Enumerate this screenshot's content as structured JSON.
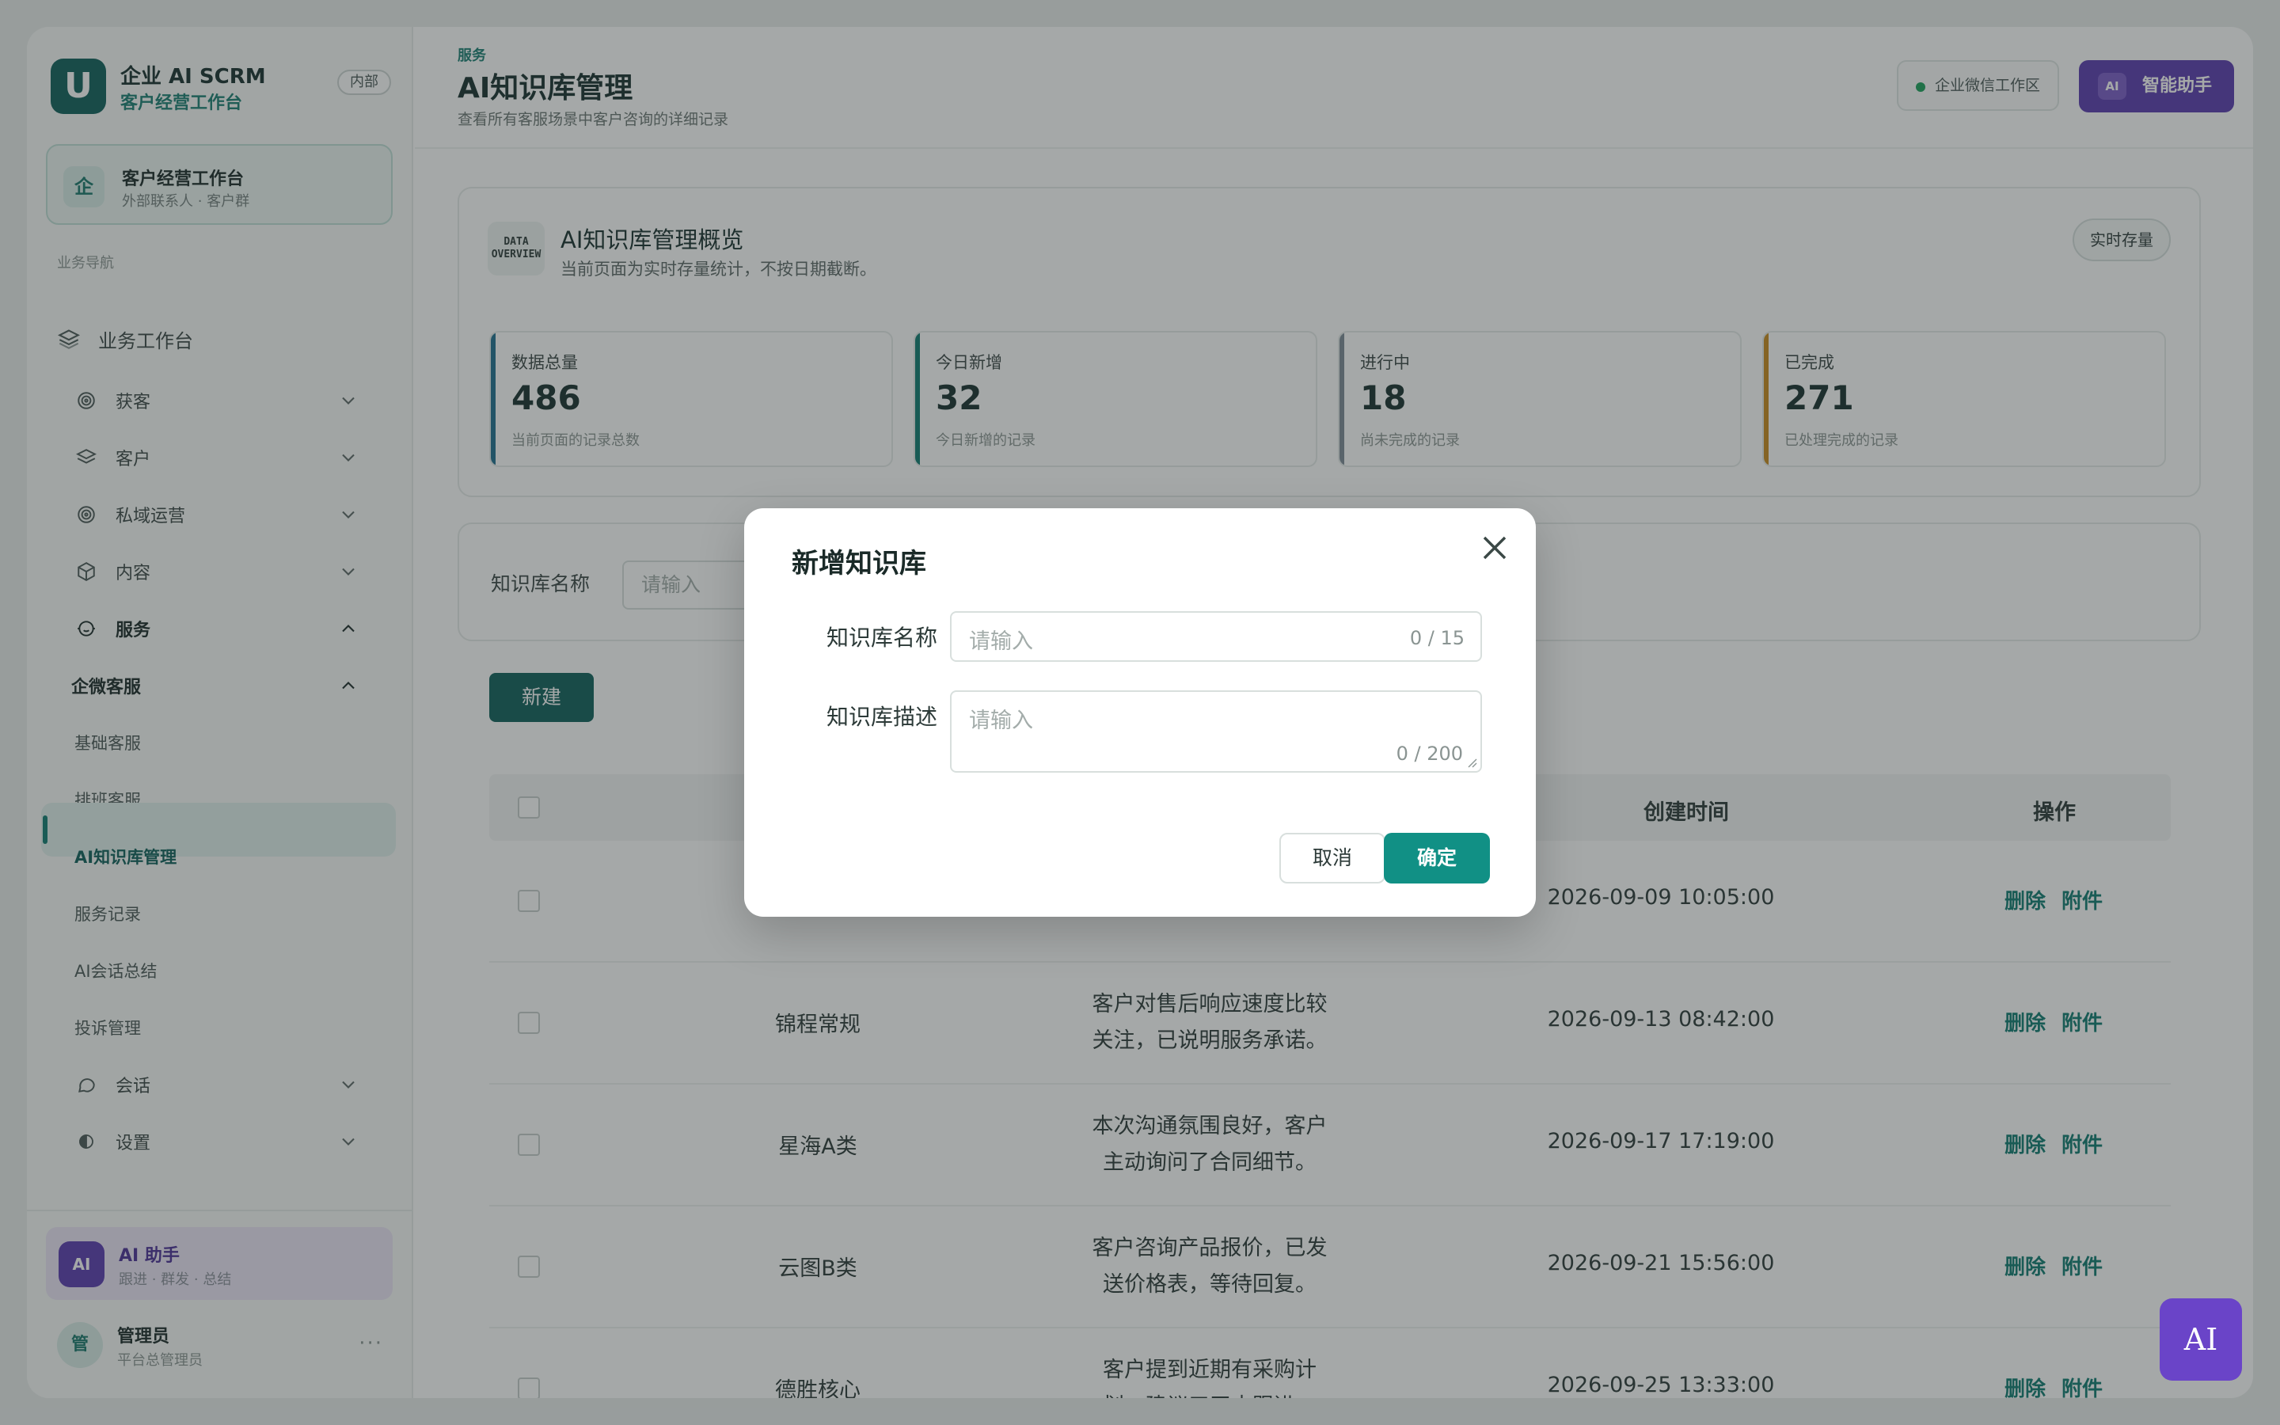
{
  "app": {
    "brand_logo": "U",
    "brand_title": "企业 AI SCRM",
    "brand_subtitle": "客户经营工作台",
    "internal_badge": "内部"
  },
  "workspace_card": {
    "icon_text": "企",
    "title": "客户经营工作台",
    "subtitle": "外部联系人 · 客户群"
  },
  "sidebar": {
    "caption": "业务导航",
    "top_item": "业务工作台",
    "groups": [
      {
        "label": "获客",
        "icon": "target-icon",
        "expanded": false
      },
      {
        "label": "客户",
        "icon": "layers-icon",
        "expanded": false
      },
      {
        "label": "私域运营",
        "icon": "target-icon",
        "expanded": false
      },
      {
        "label": "内容",
        "icon": "cube-icon",
        "expanded": false
      },
      {
        "label": "服务",
        "icon": "service-face-icon",
        "expanded": true
      },
      {
        "label": "会话",
        "icon": "chat-icon",
        "expanded": false
      },
      {
        "label": "设置",
        "icon": "settings-icon",
        "expanded": false
      }
    ],
    "subgroup": "企微客服",
    "leaves": [
      "基础客服",
      "排班客服",
      "AI知识库管理",
      "服务记录",
      "AI会话总结",
      "投诉管理"
    ],
    "active_leaf": "AI知识库管理"
  },
  "ai_assistant_card": {
    "icon_text": "AI",
    "title": "AI 助手",
    "subtitle": "跟进 · 群发 · 总结"
  },
  "admin": {
    "avatar_text": "管",
    "name": "管理员",
    "role": "平台总管理员",
    "more": "···"
  },
  "header": {
    "breadcrumb": "服务",
    "title": "AI知识库管理",
    "subtitle": "查看所有客服场景中客户咨询的详细记录",
    "env_label": "企业微信工作区",
    "assistant_mini": "AI",
    "assistant_label": "智能助手"
  },
  "overview": {
    "icon_text_1": "DATA",
    "icon_text_2": "OVERVIEW",
    "title": "AI知识库管理概览",
    "subtitle": "当前页面为实时存量统计，不按日期截断。",
    "tag": "实时存量",
    "stats": [
      {
        "label": "数据总量",
        "value": "486",
        "hint": "当前页面的记录总数",
        "color": "#1f6f8f"
      },
      {
        "label": "今日新增",
        "value": "32",
        "hint": "今日新增的记录",
        "color": "#0f7a70"
      },
      {
        "label": "进行中",
        "value": "18",
        "hint": "尚未完成的记录",
        "color": "#7c8a96"
      },
      {
        "label": "已完成",
        "value": "271",
        "hint": "已处理完成的记录",
        "color": "#c98a1e"
      }
    ]
  },
  "filter": {
    "label": "知识库名称",
    "placeholder": "请输入"
  },
  "toolbar": {
    "new_label": "新建"
  },
  "table": {
    "headers": {
      "time": "创建时间",
      "action": "操作"
    },
    "action_delete": "删除",
    "action_attach": "附件",
    "rows": [
      {
        "name": "",
        "desc_1": "",
        "desc_2": "",
        "time": "2026-09-09 10:05:00"
      },
      {
        "name": "锦程常规",
        "desc_1": "客户对售后响应速度比较",
        "desc_2": "关注，已说明服务承诺。",
        "time": "2026-09-13 08:42:00"
      },
      {
        "name": "星海A类",
        "desc_1": "本次沟通氛围良好，客户",
        "desc_2": "主动询问了合同细节。",
        "time": "2026-09-17 17:19:00"
      },
      {
        "name": "云图B类",
        "desc_1": "客户咨询产品报价，已发",
        "desc_2": "送价格表，等待回复。",
        "time": "2026-09-21 15:56:00"
      },
      {
        "name": "德胜核心",
        "desc_1": "客户提到近期有采购计",
        "desc_2": "划，建议三天内跟进。",
        "time": "2026-09-25 13:33:00"
      }
    ]
  },
  "fab": {
    "label": "AI"
  },
  "dialog": {
    "title": "新增知识库",
    "name_label": "知识库名称",
    "name_placeholder": "请输入",
    "name_count": "0 / 15",
    "desc_label": "知识库描述",
    "desc_placeholder": "请输入",
    "desc_count": "0 / 200",
    "cancel": "取消",
    "confirm": "确定"
  }
}
